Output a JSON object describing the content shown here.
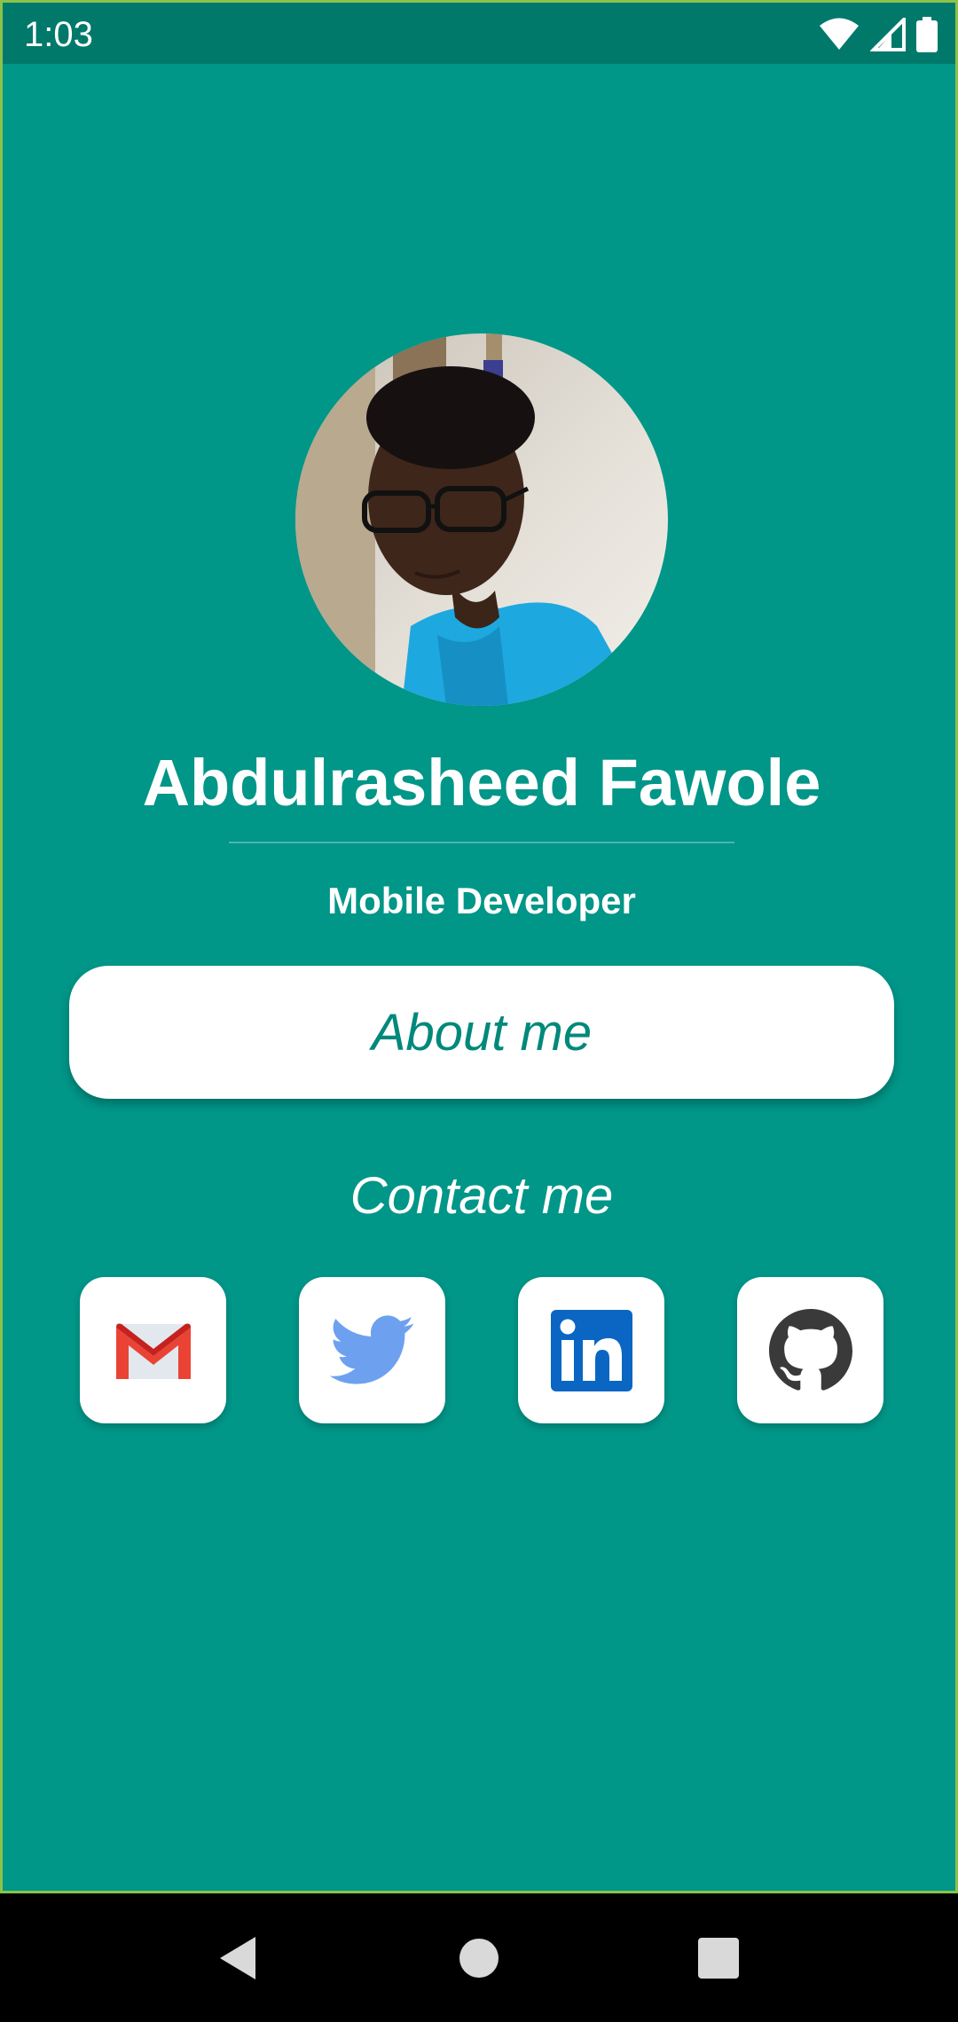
{
  "status_bar": {
    "time": "1:03",
    "icons": [
      "wifi-icon",
      "cell-signal-icon",
      "battery-icon"
    ]
  },
  "profile": {
    "name": "Abdulrasheed Fawole",
    "role": "Mobile Developer",
    "avatar": "profile-photo"
  },
  "about_button": {
    "label": "About me"
  },
  "contact": {
    "title": "Contact me",
    "links": [
      {
        "icon": "gmail-icon"
      },
      {
        "icon": "twitter-icon"
      },
      {
        "icon": "linkedin-icon"
      },
      {
        "icon": "github-icon"
      }
    ]
  },
  "navigation": {
    "buttons": [
      "back-icon",
      "home-icon",
      "recents-icon"
    ]
  },
  "colors": {
    "background": "#009688",
    "status_bar": "#00796b",
    "accent_text": "#00897b",
    "border": "#8bc34a"
  }
}
